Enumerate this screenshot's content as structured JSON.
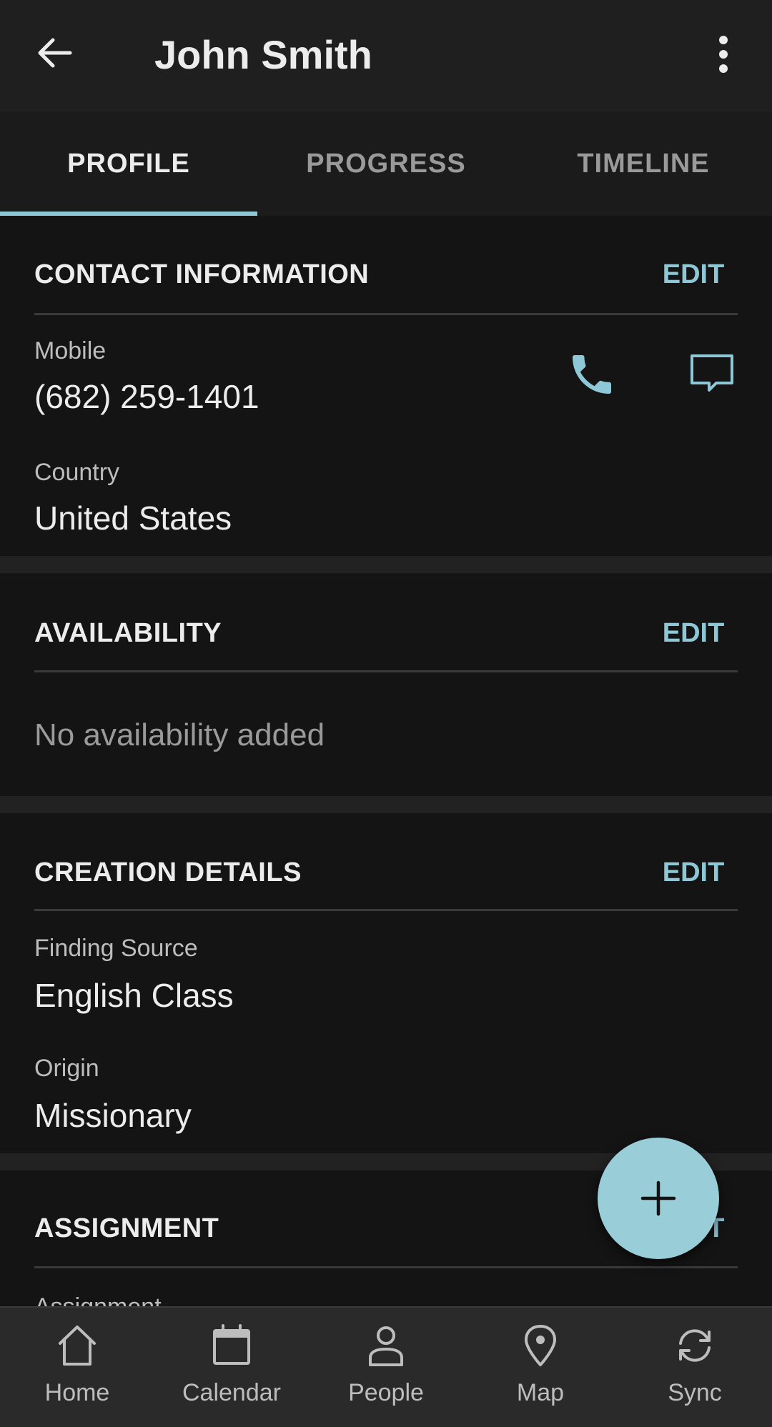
{
  "appbar": {
    "title": "John Smith",
    "back_icon": "arrow-left-icon",
    "menu_icon": "more-vert-icon"
  },
  "tabs": [
    {
      "label": "PROFILE",
      "active": true
    },
    {
      "label": "PROGRESS",
      "active": false
    },
    {
      "label": "TIMELINE",
      "active": false
    }
  ],
  "contact": {
    "heading": "CONTACT INFORMATION",
    "edit": "EDIT",
    "mobile_label": "Mobile",
    "mobile_value": "(682) 259-1401",
    "country_label": "Country",
    "country_value": "United States",
    "call_icon": "phone-icon",
    "message_icon": "message-icon"
  },
  "availability": {
    "heading": "AVAILABILITY",
    "edit": "EDIT",
    "empty_text": "No availability added"
  },
  "creation": {
    "heading": "CREATION DETAILS",
    "edit": "EDIT",
    "source_label": "Finding Source",
    "source_value": "English Class",
    "origin_label": "Origin",
    "origin_value": "Missionary"
  },
  "assignment": {
    "heading": "ASSIGNMENT",
    "edit": "EDIT",
    "label": "Assignment"
  },
  "fab": {
    "icon": "plus-icon"
  },
  "bottom_nav": [
    {
      "label": "Home",
      "icon": "home-icon"
    },
    {
      "label": "Calendar",
      "icon": "calendar-icon"
    },
    {
      "label": "People",
      "icon": "person-icon"
    },
    {
      "label": "Map",
      "icon": "map-pin-icon"
    },
    {
      "label": "Sync",
      "icon": "sync-icon"
    }
  ],
  "colors": {
    "accent": "#8ec8d6",
    "fab": "#99ced9",
    "background": "#141414",
    "appbar": "#1f1f1f"
  }
}
